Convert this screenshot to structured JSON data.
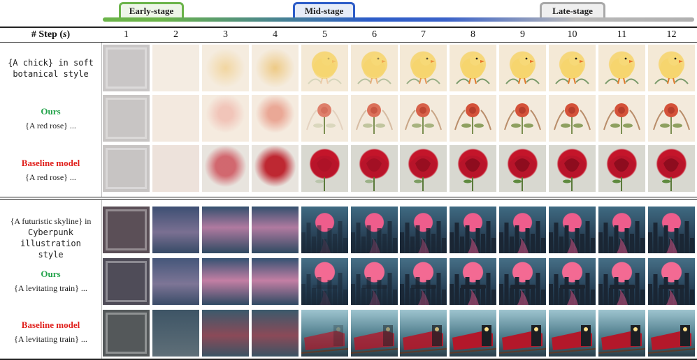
{
  "stages": {
    "early": "Early-stage",
    "mid": "Mid-stage",
    "late": "Late-stage"
  },
  "header": {
    "step_label_prefix": "# Step (",
    "step_label_var": "s",
    "step_label_suffix": ")",
    "steps": [
      "1",
      "2",
      "3",
      "4",
      "5",
      "6",
      "7",
      "8",
      "9",
      "10",
      "11",
      "12"
    ]
  },
  "groups": [
    {
      "rows": [
        {
          "kind": "prompt",
          "lines": [
            "{A chick} in soft",
            "botanical style"
          ]
        },
        {
          "kind": "method",
          "method": "Ours",
          "prompt": "{A red rose} ..."
        },
        {
          "kind": "method",
          "method": "Baseline model",
          "prompt": "{A red rose} ..."
        }
      ]
    },
    {
      "rows": [
        {
          "kind": "prompt",
          "lines": [
            "{A futuristic skyline} in",
            "Cyberpunk illustration",
            "style"
          ]
        },
        {
          "kind": "method",
          "method": "Ours",
          "prompt": "{A levitating train} ..."
        },
        {
          "kind": "method",
          "method": "Baseline model",
          "prompt": "{A levitating train} ..."
        }
      ]
    }
  ],
  "colors": {
    "ours": "#22a34a",
    "baseline": "#e0201c",
    "early_stage": "#6bb44a",
    "mid_stage": "#2c5cc8",
    "late_stage": "#a8a8a8"
  }
}
